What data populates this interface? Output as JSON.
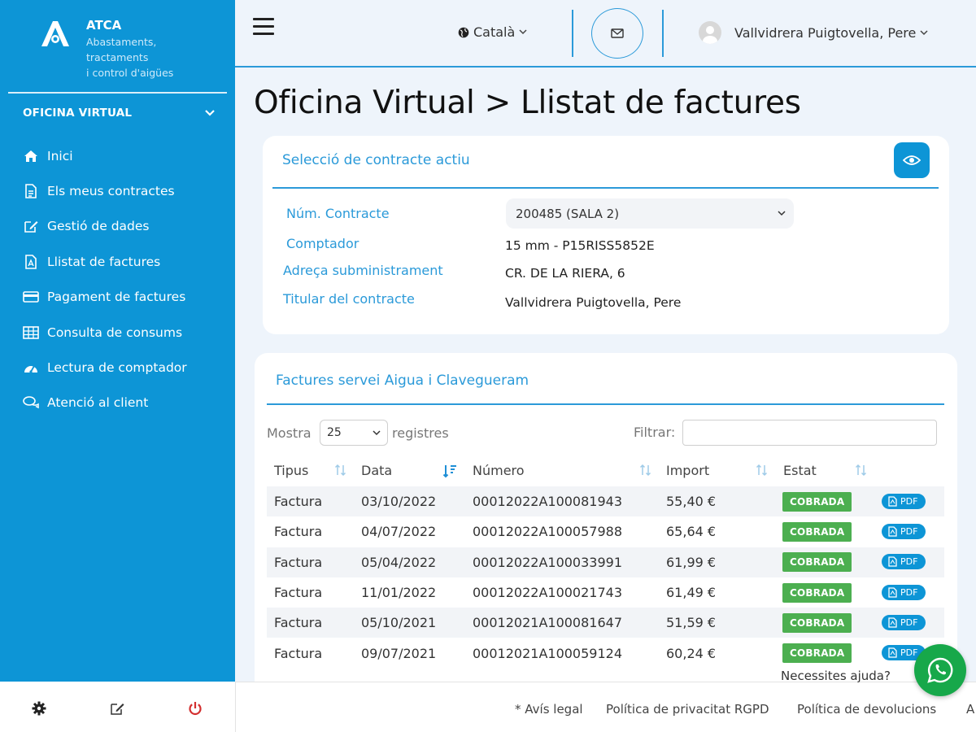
{
  "brand": {
    "name": "ATCA",
    "subtitle_line1": "Abastaments,",
    "subtitle_line2": "tractaments",
    "subtitle_line3": "i control d'aigües"
  },
  "sidebar": {
    "section_title": "OFICINA VIRTUAL",
    "items": [
      {
        "label": "Inici",
        "icon": "home-icon"
      },
      {
        "label": "Els meus contractes",
        "icon": "document-icon"
      },
      {
        "label": "Gestió de dades",
        "icon": "edit-icon"
      },
      {
        "label": "Llistat de factures",
        "icon": "pdf-file-icon"
      },
      {
        "label": "Pagament de factures",
        "icon": "credit-card-icon"
      },
      {
        "label": "Consulta de consums",
        "icon": "table-icon"
      },
      {
        "label": "Lectura de comptador",
        "icon": "meter-icon"
      },
      {
        "label": "Atenció al client",
        "icon": "chat-icon"
      }
    ]
  },
  "topbar": {
    "language": "Català",
    "user_name": "Vallvidrera Puigtovella, Pere"
  },
  "page": {
    "title": "Oficina Virtual > Llistat de factures"
  },
  "contract_card": {
    "title": "Selecció de contracte actiu",
    "fields": {
      "contract_label": "Núm. Contracte",
      "contract_value": "200485 (SALA 2)",
      "meter_label": "Comptador",
      "meter_value": "15 mm - P15RISS5852E",
      "address_label": "Adreça subministrament",
      "address_value": "CR. DE LA RIERA, 6",
      "holder_label": "Titular del contracte",
      "holder_value": "Vallvidrera Puigtovella, Pere"
    }
  },
  "invoices_card": {
    "title": "Factures servei Aigua i Clavegueram",
    "show_label": "Mostra",
    "page_size": "25",
    "records_label": "registres",
    "filter_label": "Filtrar:",
    "columns": [
      "Tipus",
      "Data",
      "Número",
      "Import",
      "Estat"
    ],
    "rows": [
      {
        "type": "Factura",
        "date": "03/10/2022",
        "number": "00012022A100081943",
        "amount": "55,40 €",
        "status": "COBRADA",
        "pdf": "PDF"
      },
      {
        "type": "Factura",
        "date": "04/07/2022",
        "number": "00012022A100057988",
        "amount": "65,64 €",
        "status": "COBRADA",
        "pdf": "PDF"
      },
      {
        "type": "Factura",
        "date": "05/04/2022",
        "number": "00012022A100033991",
        "amount": "61,99 €",
        "status": "COBRADA",
        "pdf": "PDF"
      },
      {
        "type": "Factura",
        "date": "11/01/2022",
        "number": "00012022A100021743",
        "amount": "61,49 €",
        "status": "COBRADA",
        "pdf": "PDF"
      },
      {
        "type": "Factura",
        "date": "05/10/2021",
        "number": "00012021A100081647",
        "amount": "51,59 €",
        "status": "COBRADA",
        "pdf": "PDF"
      },
      {
        "type": "Factura",
        "date": "09/07/2021",
        "number": "00012021A100059124",
        "amount": "60,24 €",
        "status": "COBRADA",
        "pdf": "PDF"
      }
    ]
  },
  "footer": {
    "links": [
      "* Avís legal",
      "Política de privacitat RGPD",
      "Política de devolucions",
      "A"
    ]
  },
  "help": {
    "text": "Necessites ajuda?"
  },
  "colors": {
    "primary": "#0d95d6",
    "accent_line": "#2b9ad9",
    "status_paid": "#4caf50",
    "whatsapp": "#17a84a"
  }
}
